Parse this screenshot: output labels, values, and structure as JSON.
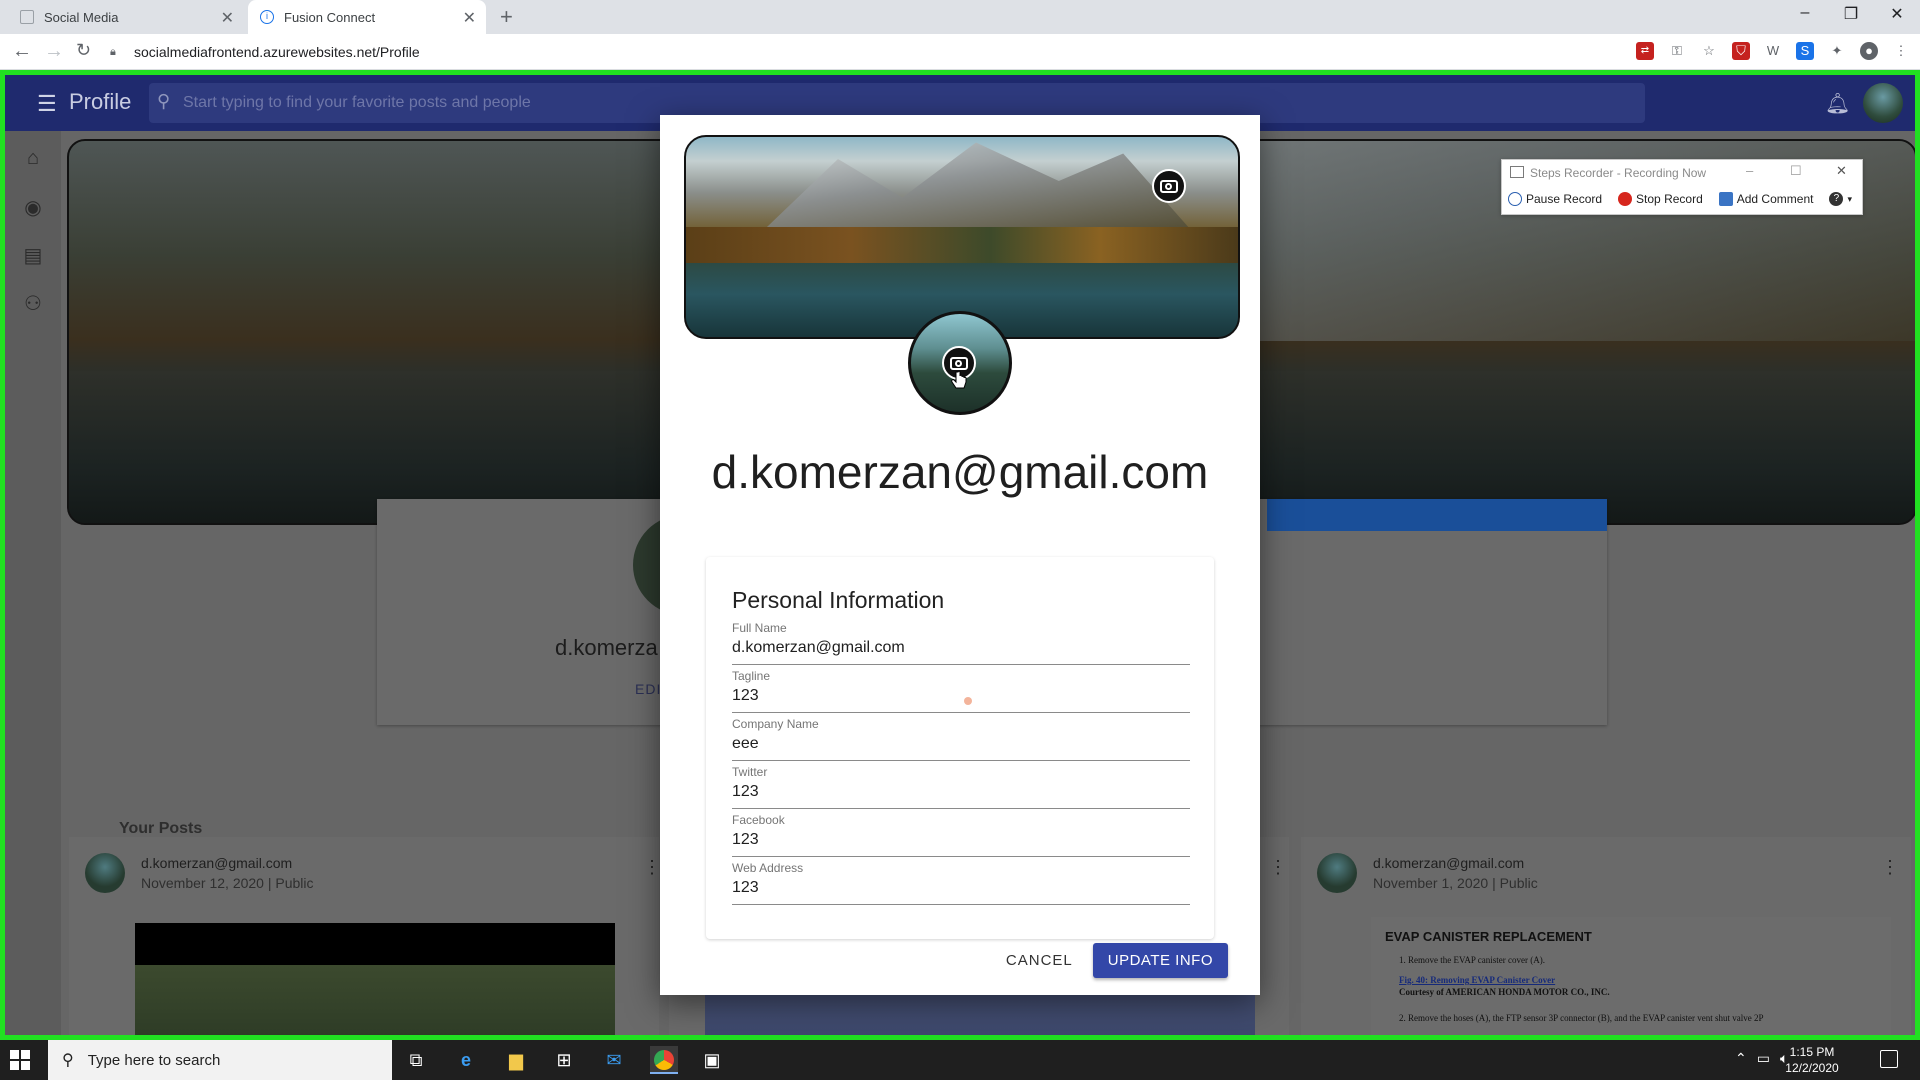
{
  "browser": {
    "tabs": [
      {
        "label": "Social Media"
      },
      {
        "label": "Fusion Connect"
      }
    ],
    "url": "socialmediafrontend.azurewebsites.net/Profile"
  },
  "app": {
    "page_title": "Profile",
    "search_placeholder": "Start typing to find your favorite posts and people"
  },
  "background": {
    "profile_name": "d.komerza",
    "edit_label": "EDIT",
    "posts_heading": "Your Posts",
    "posts": [
      {
        "author": "d.komerzan@gmail.com",
        "meta": "November 12, 2020 | Public"
      },
      {
        "author": "d.komerzan@gmail.com",
        "meta": "November 1, 2020 | Public"
      }
    ],
    "doc_preview": {
      "heading": "EVAP CANISTER REPLACEMENT",
      "line1": "1.   Remove the EVAP canister cover (A).",
      "link": "Fig. 40: Removing EVAP Canister Cover",
      "courtesy": "Courtesy of AMERICAN HONDA MOTOR CO., INC.",
      "line2": "2.   Remove the hoses (A), the FTP sensor 3P connector (B), and the EVAP canister vent shut valve 2P"
    }
  },
  "steps_recorder": {
    "title": "Steps Recorder - Recording Now",
    "pause": "Pause Record",
    "stop": "Stop Record",
    "comment": "Add Comment"
  },
  "modal": {
    "email_heading": "d.komerzan@gmail.com",
    "form_title": "Personal Information",
    "fields": [
      {
        "label": "Full Name",
        "value": "d.komerzan@gmail.com"
      },
      {
        "label": "Tagline",
        "value": "123"
      },
      {
        "label": "Company Name",
        "value": "eee"
      },
      {
        "label": "Twitter",
        "value": "123"
      },
      {
        "label": "Facebook",
        "value": "123"
      },
      {
        "label": "Web Address",
        "value": "123"
      }
    ],
    "cancel_label": "CANCEL",
    "update_label": "UPDATE INFO"
  },
  "taskbar": {
    "search_placeholder": "Type here to search",
    "time": "1:15 PM",
    "date": "12/2/2020"
  },
  "colors": {
    "appbar": "#1f2a6e",
    "primary_button": "#3347a8",
    "recording_border": "#21e021"
  }
}
